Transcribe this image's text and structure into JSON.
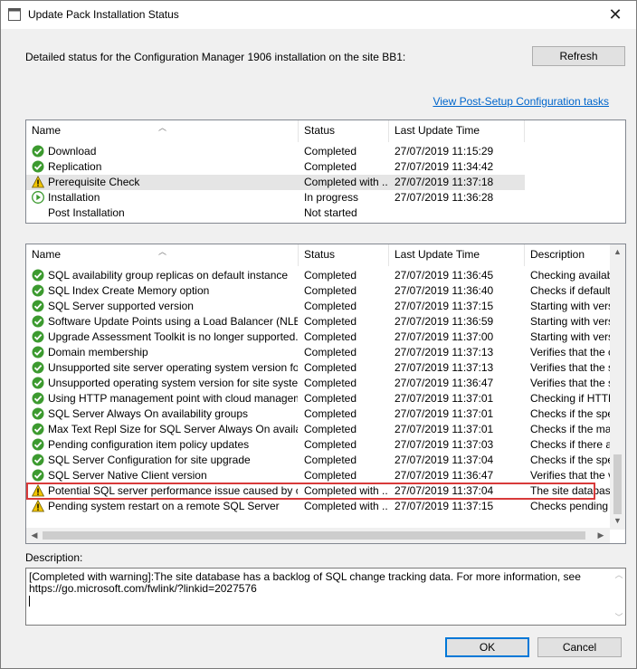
{
  "window": {
    "title": "Update Pack Installation Status",
    "close_glyph": "✕"
  },
  "intro_text": "Detailed status for the Configuration Manager 1906 installation on the site BB1:",
  "refresh_label": "Refresh",
  "post_setup_link": "View Post-Setup Configuration tasks",
  "phases": {
    "columns": [
      "Name",
      "Status",
      "Last Update Time"
    ],
    "rows": [
      {
        "icon": "check",
        "name": "Download",
        "status": "Completed",
        "time": "27/07/2019 11:15:29"
      },
      {
        "icon": "check",
        "name": "Replication",
        "status": "Completed",
        "time": "27/07/2019 11:34:42"
      },
      {
        "icon": "warning",
        "name": "Prerequisite Check",
        "status": "Completed with ...",
        "time": "27/07/2019 11:37:18",
        "selected": true
      },
      {
        "icon": "play",
        "name": "Installation",
        "status": "In progress",
        "time": "27/07/2019 11:36:28"
      },
      {
        "icon": "none",
        "name": "Post Installation",
        "status": "Not started",
        "time": ""
      }
    ]
  },
  "checks": {
    "columns": [
      "Name",
      "Status",
      "Last Update Time",
      "Description"
    ],
    "rows": [
      {
        "icon": "check",
        "name": "SQL availability group replicas on default instance",
        "status": "Completed",
        "time": "27/07/2019 11:36:45",
        "desc": "Checking availabili"
      },
      {
        "icon": "check",
        "name": "SQL Index Create Memory option",
        "status": "Completed",
        "time": "27/07/2019 11:36:40",
        "desc": "Checks if default v"
      },
      {
        "icon": "check",
        "name": "SQL Server supported version",
        "status": "Completed",
        "time": "27/07/2019 11:37:15",
        "desc": "Starting with versic"
      },
      {
        "icon": "check",
        "name": "Software Update Points using a Load Balancer (NLB/HL...",
        "status": "Completed",
        "time": "27/07/2019 11:36:59",
        "desc": "Starting with versic"
      },
      {
        "icon": "check",
        "name": "Upgrade Assessment Toolkit is no longer supported.",
        "status": "Completed",
        "time": "27/07/2019 11:37:00",
        "desc": "Starting with versic"
      },
      {
        "icon": "check",
        "name": "Domain membership",
        "status": "Completed",
        "time": "27/07/2019 11:37:13",
        "desc": "Verifies that the co"
      },
      {
        "icon": "check",
        "name": "Unsupported site server operating system version for Set...",
        "status": "Completed",
        "time": "27/07/2019 11:37:13",
        "desc": "Verifies that the site"
      },
      {
        "icon": "check",
        "name": "Unsupported operating system version for site system role",
        "status": "Completed",
        "time": "27/07/2019 11:36:47",
        "desc": "Verifies that the site"
      },
      {
        "icon": "check",
        "name": "Using HTTP management point with cloud management ...",
        "status": "Completed",
        "time": "27/07/2019 11:37:01",
        "desc": "Checking if HTTP"
      },
      {
        "icon": "check",
        "name": "SQL Server Always On availability groups",
        "status": "Completed",
        "time": "27/07/2019 11:37:01",
        "desc": "Checks if the spec"
      },
      {
        "icon": "check",
        "name": "Max Text Repl Size for SQL Server Always On availabilit...",
        "status": "Completed",
        "time": "27/07/2019 11:37:01",
        "desc": "Checks if the max"
      },
      {
        "icon": "check",
        "name": "Pending configuration item policy updates",
        "status": "Completed",
        "time": "27/07/2019 11:37:03",
        "desc": "Checks if there are"
      },
      {
        "icon": "check",
        "name": "SQL Server Configuration for site upgrade",
        "status": "Completed",
        "time": "27/07/2019 11:37:04",
        "desc": "Checks if the spec"
      },
      {
        "icon": "check",
        "name": "SQL Server Native Client version",
        "status": "Completed",
        "time": "27/07/2019 11:36:47",
        "desc": "Verifies that the ve"
      },
      {
        "icon": "warning",
        "name": "Potential SQL server performance issue caused by chan...",
        "status": "Completed with ...",
        "time": "27/07/2019 11:37:04",
        "desc": "The site database",
        "highlighted": true
      },
      {
        "icon": "warning",
        "name": "Pending system restart on a remote SQL Server",
        "status": "Completed with ...",
        "time": "27/07/2019 11:37:15",
        "desc": "Checks pending sy"
      }
    ]
  },
  "description_label": "Description:",
  "description_line1": "[Completed with warning]:The site database has a backlog of SQL change tracking data. For more information, see",
  "description_line2": "https://go.microsoft.com/fwlink/?linkid=2027576",
  "ok_label": "OK",
  "cancel_label": "Cancel",
  "colors": {
    "accent": "#0078d7",
    "link": "#0066cc",
    "highlight": "#d83a3a",
    "check": "#3c9a2f",
    "warning": "#f2c500"
  }
}
